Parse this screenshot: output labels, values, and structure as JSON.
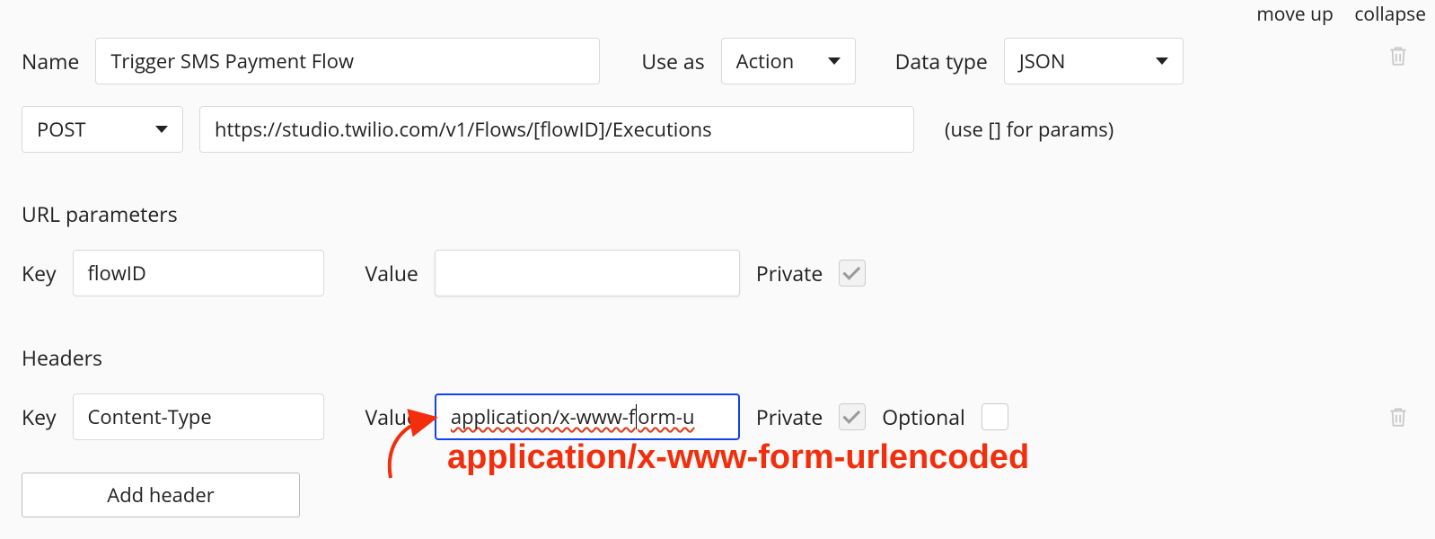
{
  "topLinks": {
    "moveUp": "move up",
    "collapse": "collapse"
  },
  "labels": {
    "name": "Name",
    "useAs": "Use as",
    "dataType": "Data type",
    "key": "Key",
    "value": "Value",
    "private": "Private",
    "optional": "Optional"
  },
  "fields": {
    "name": "Trigger SMS Payment Flow",
    "useAs": "Action",
    "dataType": "JSON",
    "method": "POST",
    "url": "https://studio.twilio.com/v1/Flows/[flowID]/Executions",
    "urlHint": "(use [] for params)"
  },
  "sections": {
    "urlParams": "URL parameters",
    "headers": "Headers"
  },
  "urlParams": [
    {
      "key": "flowID",
      "value": "",
      "private": true
    }
  ],
  "headers": [
    {
      "key": "Content-Type",
      "value_part1": "application/x-www-f",
      "value_part2": "orm-u",
      "private": true,
      "optional": false
    }
  ],
  "buttons": {
    "addHeader": "Add header"
  },
  "annotation": "application/x-www-form-urlencoded"
}
